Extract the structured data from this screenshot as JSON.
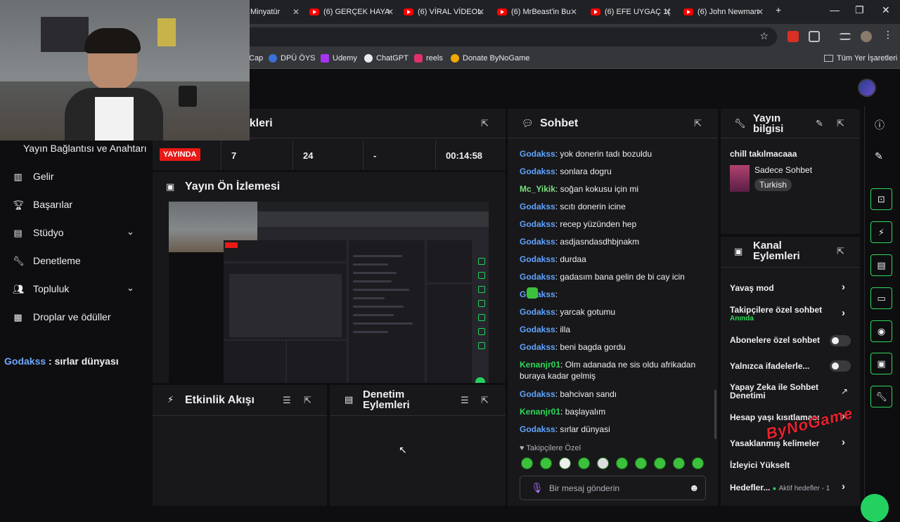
{
  "browser": {
    "tabs": [
      {
        "label": "Minyatür",
        "icon": "youtube-icon"
      },
      {
        "label": "(6) GERÇEK HAYA",
        "icon": "youtube-icon"
      },
      {
        "label": "(6) VİRAL VİDEOL",
        "icon": "youtube-icon"
      },
      {
        "label": "(6) MrBeast'in Bu",
        "icon": "youtube-icon"
      },
      {
        "label": "(6) EFE UYGAÇ 1(",
        "icon": "youtube-icon"
      },
      {
        "label": "(6) John Newman",
        "icon": "youtube-icon"
      }
    ],
    "new_tab": "+",
    "bookmarks": [
      {
        "label": "Cap"
      },
      {
        "label": "DPÜ ÖYS"
      },
      {
        "label": "Udemy"
      },
      {
        "label": "ChatGPT"
      },
      {
        "label": "reels"
      },
      {
        "label": "Donate ByNoGame"
      }
    ],
    "all_bookmarks": "Tüm Yer İşaretleri"
  },
  "sidebar": {
    "top_item": "Yayın Bağlantısı ve Anahtarı",
    "items": [
      {
        "label": "Gelir",
        "icon": "chart-icon"
      },
      {
        "label": "Başarılar",
        "icon": "trophy-icon"
      },
      {
        "label": "Stüdyo",
        "icon": "studio-icon",
        "expandable": true
      },
      {
        "label": "Denetleme",
        "icon": "wrench-icon"
      },
      {
        "label": "Topluluk",
        "icon": "community-icon",
        "expandable": true
      },
      {
        "label": "Droplar ve ödüller",
        "icon": "drops-icon"
      }
    ]
  },
  "overlay": {
    "user": "Godakss",
    "text": " : sırlar dünyası"
  },
  "stats": {
    "title_fragment": "tikleri",
    "live_label": "YAYINDA",
    "viewers": "7",
    "followers": "24",
    "other": "-",
    "uptime": "00:14:58"
  },
  "preview": {
    "title": "Yayın Ön İzlemesi"
  },
  "activity": {
    "title": "Etkinlik Akışı"
  },
  "mod_actions": {
    "title": "Denetim Eylemleri"
  },
  "chat": {
    "title": "Sohbet",
    "messages": [
      {
        "user": "Godakss",
        "text": "yok donerin tadı bozuldu",
        "color": "blue"
      },
      {
        "user": "Godakss",
        "text": "sonlara dogru",
        "color": "blue"
      },
      {
        "user": "Mc_Yikik",
        "text": "soğan kokusu için mi",
        "color": "lgreen"
      },
      {
        "user": "Godakss",
        "text": "scıtı donerin icine",
        "color": "blue"
      },
      {
        "user": "Godakss",
        "text": "recep yüzünden hep",
        "color": "blue"
      },
      {
        "user": "Godakss",
        "text": "asdjasndasdhbjnakm",
        "color": "blue"
      },
      {
        "user": "Godakss",
        "text": "durdaa",
        "color": "blue"
      },
      {
        "user": "Godakss",
        "text": "gadasım bana gelin de bi cay icin",
        "color": "blue"
      },
      {
        "user": "Godakss",
        "text": "",
        "color": "blue"
      },
      {
        "user": "Godakss",
        "text": "yarcak gotumu",
        "color": "blue"
      },
      {
        "user": "Godakss",
        "text": "illa",
        "color": "blue"
      },
      {
        "user": "Godakss",
        "text": "beni bagda gordu",
        "color": "blue"
      },
      {
        "user": "Kenanjr01",
        "text": "Olm adanada ne sis oldu afrikadan buraya kadar gelmiş",
        "color": "green"
      },
      {
        "user": "Godakss",
        "text": "bahcivan sandı",
        "color": "blue"
      },
      {
        "user": "Kenanjr01",
        "text": "başlayalım",
        "color": "green"
      },
      {
        "user": "Godakss",
        "text": "sırlar dünyasi",
        "color": "blue"
      }
    ],
    "followers_only_label": "Takipçilere Özel",
    "input_placeholder": "Bir mesaj gönderin"
  },
  "stream_info": {
    "title_line1": "Yayın",
    "title_line2": "bilgisi",
    "stream_title": "chill takılmacaaa",
    "category": "Sadece Sohbet",
    "language_tag": "Turkish"
  },
  "channel_actions": {
    "title_line1": "Kanal",
    "title_line2": "Eylemleri",
    "rows": [
      {
        "label": "Yavaş mod",
        "control": "chevron"
      },
      {
        "label": "Takipçilere özel sohbet",
        "sub": "Anında",
        "control": "chevron"
      },
      {
        "label": "Abonelere özel sohbet",
        "control": "toggle"
      },
      {
        "label": "Yalnızca ifadelerle...",
        "control": "toggle"
      },
      {
        "label": "Yapay Zeka ile Sohbet Denetimi",
        "control": "external"
      },
      {
        "label": "Hesap yaşı kısıtlaması",
        "control": "chevron"
      },
      {
        "label": "Yasaklanmış kelimeler",
        "control": "chevron"
      },
      {
        "label": "İzleyici Yükselt",
        "control": "none"
      },
      {
        "label": "Hedefler...",
        "sub": "Aktif hedefler - 1",
        "control": "chevron"
      }
    ]
  },
  "watermark": "ByNoGame",
  "colors": {
    "accent_green": "#2ed95a",
    "live_red": "#e91916",
    "user_blue": "#5fa3ff",
    "bg": "#0e0e10",
    "panel": "#18181b"
  }
}
